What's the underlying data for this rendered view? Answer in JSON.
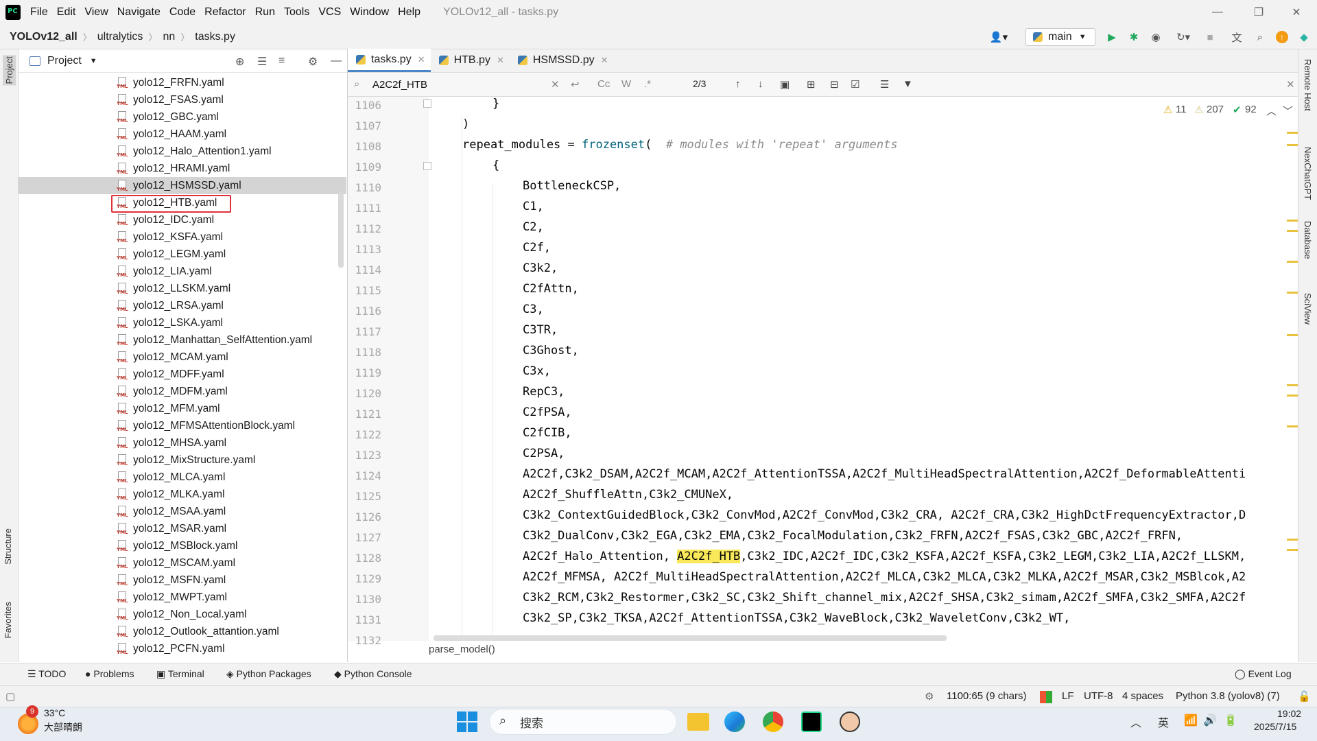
{
  "menubar": {
    "items": [
      "File",
      "Edit",
      "View",
      "Navigate",
      "Code",
      "Refactor",
      "Run",
      "Tools",
      "VCS",
      "Window",
      "Help"
    ],
    "title": "YOLOv12_all - tasks.py"
  },
  "navbar": {
    "crumbs": [
      "YOLOv12_all",
      "ultralytics",
      "nn",
      "tasks.py"
    ],
    "branch": "main"
  },
  "project_panel": {
    "title": "Project",
    "files": [
      "yolo12_FRFN.yaml",
      "yolo12_FSAS.yaml",
      "yolo12_GBC.yaml",
      "yolo12_HAAM.yaml",
      "yolo12_Halo_Attention1.yaml",
      "yolo12_HRAMI.yaml",
      "yolo12_HSMSSD.yaml",
      "yolo12_HTB.yaml",
      "yolo12_IDC.yaml",
      "yolo12_KSFA.yaml",
      "yolo12_LEGM.yaml",
      "yolo12_LIA.yaml",
      "yolo12_LLSKM.yaml",
      "yolo12_LRSA.yaml",
      "yolo12_LSKA.yaml",
      "yolo12_Manhattan_SelfAttention.yaml",
      "yolo12_MCAM.yaml",
      "yolo12_MDFF.yaml",
      "yolo12_MDFM.yaml",
      "yolo12_MFM.yaml",
      "yolo12_MFMSAttentionBlock.yaml",
      "yolo12_MHSA.yaml",
      "yolo12_MixStructure.yaml",
      "yolo12_MLCA.yaml",
      "yolo12_MLKA.yaml",
      "yolo12_MSAA.yaml",
      "yolo12_MSAR.yaml",
      "yolo12_MSBlock.yaml",
      "yolo12_MSCAM.yaml",
      "yolo12_MSFN.yaml",
      "yolo12_MWPT.yaml",
      "yolo12_Non_Local.yaml",
      "yolo12_Outlook_attantion.yaml",
      "yolo12_PCFN.yaml"
    ],
    "selected": "yolo12_HSMSSD.yaml",
    "boxed": "yolo12_HTB.yaml"
  },
  "editor": {
    "tabs": [
      "tasks.py",
      "HTB.py",
      "HSMSSD.py"
    ],
    "active_tab": "tasks.py",
    "search": {
      "query": "A2C2f_HTB",
      "match_count": "2/3",
      "cc": "Cc",
      "w": "W",
      "regex": ".*"
    },
    "inspections": {
      "warnings": "11",
      "weak_warnings": "207",
      "ok": "92"
    },
    "line_numbers": [
      "1106",
      "1107",
      "1108",
      "1109",
      "1110",
      "1111",
      "1112",
      "1113",
      "1114",
      "1115",
      "1116",
      "1117",
      "1118",
      "1119",
      "1120",
      "1121",
      "1122",
      "1123",
      "1124",
      "1125",
      "1126",
      "1127",
      "1128",
      "1129",
      "1130",
      "1131",
      "1132"
    ],
    "lines": {
      "l1106": "}",
      "l1107": ")",
      "l1108_a": "repeat_modules = ",
      "l1108_b": "frozenset",
      "l1108_c": "(  ",
      "l1108_d": "# modules with 'repeat' arguments",
      "l1109": "{",
      "l1110": "BottleneckCSP,",
      "l1111": "C1,",
      "l1112": "C2,",
      "l1113": "C2f,",
      "l1114": "C3k2,",
      "l1115": "C2fAttn,",
      "l1116": "C3,",
      "l1117": "C3TR,",
      "l1118": "C3Ghost,",
      "l1119": "C3x,",
      "l1120": "RepC3,",
      "l1121": "C2fPSA,",
      "l1122": "C2fCIB,",
      "l1123": "C2PSA,",
      "l1124": "A2C2f,C3k2_DSAM,A2C2f_MCAM,A2C2f_AttentionTSSA,A2C2f_MultiHeadSpectralAttention,A2C2f_DeformableAttenti",
      "l1125": "A2C2f_ShuffleAttn,C3k2_CMUNeX,",
      "l1126": "C3k2_ContextGuidedBlock,C3k2_ConvMod,A2C2f_ConvMod,C3k2_CRA, A2C2f_CRA,C3k2_HighDctFrequencyExtractor,D",
      "l1127": "C3k2_DualConv,C3k2_EGA,C3k2_EMA,C3k2_FocalModulation,C3k2_FRFN,A2C2f_FSAS,C3k2_GBC,A2C2f_FRFN,",
      "l1128_a": "A2C2f_Halo_Attention, ",
      "l1128_b": "A2C2f_HTB",
      "l1128_c": ",C3k2_IDC,A2C2f_IDC,C3k2_KSFA,A2C2f_KSFA,C3k2_LEGM,C3k2_LIA,A2C2f_LLSKM,",
      "l1129": "A2C2f_MFMSA, A2C2f_MultiHeadSpectralAttention,A2C2f_MLCA,C3k2_MLCA,C3k2_MLKA,A2C2f_MSAR,C3k2_MSBlcok,A2",
      "l1130": "C3k2_RCM,C3k2_Restormer,C3k2_SC,C3k2_Shift_channel_mix,A2C2f_SHSA,C3k2_simam,A2C2f_SMFA,C3k2_SMFA,A2C2f",
      "l1131": "C3k2_SP,C3k2_TKSA,A2C2f_AttentionTSSA,C3k2_WaveBlock,C3k2_WaveletConv,C3k2_WT,"
    },
    "breadcrumb": "parse_model()"
  },
  "left_tabs": [
    "Project",
    "Structure",
    "Favorites"
  ],
  "right_tabs": [
    "Remote Host",
    "NexChatGPT",
    "Database",
    "SciView"
  ],
  "bottom_tools": [
    "TODO",
    "Problems",
    "Terminal",
    "Python Packages",
    "Python Console",
    "Event Log"
  ],
  "status": {
    "position": "1100:65 (9 chars)",
    "line_sep": "LF",
    "encoding": "UTF-8",
    "indent": "4 spaces",
    "interpreter": "Python 3.8 (yolov8) (7)"
  },
  "taskbar": {
    "weather_badge": "9",
    "temperature": "33°C",
    "weather": "大部晴朗",
    "search_placeholder": "搜索",
    "ime": "英",
    "time": "19:02",
    "date": "2025/7/15"
  },
  "colors": {
    "accent": "#4a86c8",
    "highlight": "#f9e85a",
    "box": "#e0303a"
  }
}
